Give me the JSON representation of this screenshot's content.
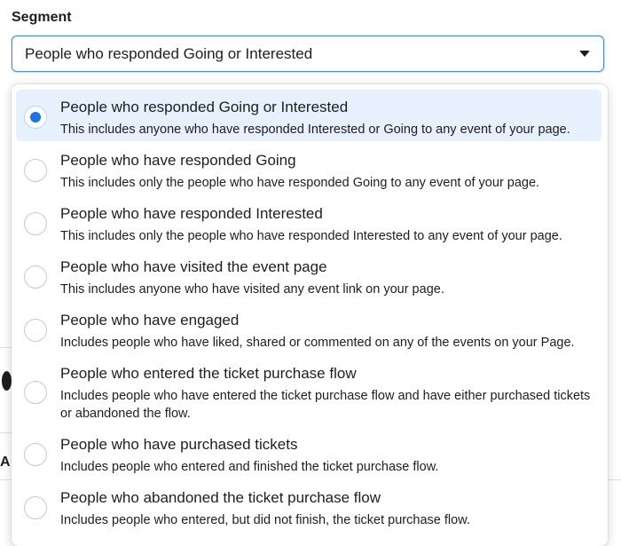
{
  "segment": {
    "label": "Segment",
    "selected_value": "People who responded Going or Interested",
    "caret_icon": "chevron-down-icon"
  },
  "options": [
    {
      "title": "People who responded Going or Interested",
      "description": "This includes anyone who have responded Interested or Going to any event of your page.",
      "selected": true
    },
    {
      "title": "People who have responded Going",
      "description": "This includes only the people who have responded Going to any event of your page.",
      "selected": false
    },
    {
      "title": "People who have responded Interested",
      "description": "This includes only the people who have responded Interested to any event of your page.",
      "selected": false
    },
    {
      "title": "People who have visited the event page",
      "description": "This includes anyone who have visited any event link on your page.",
      "selected": false
    },
    {
      "title": "People who have engaged",
      "description": "Includes people who have liked, shared or commented on any of the events on your Page.",
      "selected": false
    },
    {
      "title": "People who entered the ticket purchase flow",
      "description": "Includes people who have entered the ticket purchase flow and have either purchased tickets or abandoned the flow.",
      "selected": false
    },
    {
      "title": "People who have purchased tickets",
      "description": "Includes people who entered and finished the ticket purchase flow.",
      "selected": false
    },
    {
      "title": "People who abandoned the ticket purchase flow",
      "description": "Includes people who entered, but did not finish, the ticket purchase flow.",
      "selected": false
    }
  ],
  "colors": {
    "accent": "#1b74e4",
    "selected_row": "#e7f0fd",
    "focus_border": "#4a8fe8"
  }
}
